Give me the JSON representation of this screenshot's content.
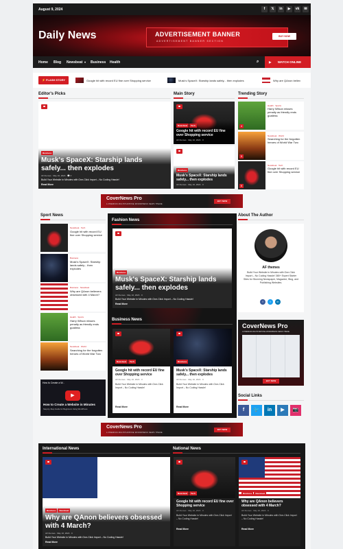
{
  "topbar": {
    "date": "August 9, 2024",
    "social_icons": [
      "f",
      "𝕏",
      "in",
      "▶",
      "vk",
      "✉"
    ]
  },
  "header": {
    "logo": "Daily News",
    "ad_title": "ADVERTISEMENT BANNER",
    "ad_sub": "ADVERTISEMENT BANNER SECTION",
    "ad_button": "BUY NOW"
  },
  "nav": {
    "items": [
      "Home",
      "Blog",
      "Newsbeat",
      "Business",
      "Health"
    ],
    "watch": "WATCH ONLINE"
  },
  "flash": {
    "label": "FLASH STORY",
    "items": [
      "Google hit with record EU fine over Shopping service",
      "Musk's SpaceX: Starship lands safely... then explodes",
      "Why are QAnon believ"
    ]
  },
  "editors": {
    "title": "Editor's Picks",
    "badge": "Business",
    "headline": "Musk's SpaceX: Starship lands safely... then explodes",
    "author": "AF themes",
    "date": "May 10, 2024",
    "comments": "0",
    "excerpt": "Build Your Website in Minutes with One-Click Import – No Coding Hassle!",
    "readmore": "Read More"
  },
  "main_story": {
    "title": "Main Story",
    "items": [
      {
        "badges": [
          "Newsbeat",
          "Tech"
        ],
        "headline": "Google hit with record EU fine over Shopping service",
        "author": "AF themes",
        "date": "May 10, 2024",
        "comments": "0"
      },
      {
        "badges": [
          "Business"
        ],
        "headline": "Musk's SpaceX: Starship lands safely... then explodes",
        "author": "AF themes",
        "date": "May 10, 2024",
        "comments": "0"
      }
    ]
  },
  "trending": {
    "title": "Trending Story",
    "items": [
      {
        "cat": "Health · Sports",
        "headline": "Harry Wilson misses penalty as friendly ends goalless",
        "num": "4"
      },
      {
        "cat": "Newsbeat · World",
        "headline": "Searching for the forgotten heroes of World War Two",
        "num": "5"
      },
      {
        "cat": "Newsbeat · Tech",
        "headline": "Google hit with record EU fine over Shopping service",
        "num": "6"
      }
    ]
  },
  "banner": {
    "title": "CoverNews Pro",
    "sub": "A PREMIUM MULTIPURPOSE WORDPRESS NEWS THEME",
    "button": "BUY NOW"
  },
  "sport": {
    "title": "Sport News",
    "items": [
      {
        "cat": "Newsbeat · Tech",
        "headline": "Google hit with record EU fine over Shopping service"
      },
      {
        "cat": "Business",
        "headline": "Musk's SpaceX: Starship lands safely... then explodes"
      },
      {
        "cat": "Business · Newsbeat",
        "headline": "Why are QAnon believers obsessed with 4 March?"
      },
      {
        "cat": "Health · Sports",
        "headline": "Harry Wilson misses penalty as friendly ends goalless"
      },
      {
        "cat": "Newsbeat · World",
        "headline": "Searching for the forgotten heroes of World War Two"
      }
    ],
    "video_title": "How to Create a Website in Minutes",
    "video_sub": "Step-by-Step Guide for Beginners Using WordPress",
    "video_top": "How to Create a W..."
  },
  "fashion": {
    "title": "Fashion News",
    "badge": "Business",
    "headline": "Musk's SpaceX: Starship lands safely... then explodes",
    "author": "AF themes",
    "date": "May 10, 2024",
    "comments": "0",
    "excerpt": "Build Your Website in Minutes with One-Click Import – No Coding Hassle!",
    "readmore": "Read More"
  },
  "business": {
    "title": "Business News",
    "items": [
      {
        "badges": [
          "Newsbeat",
          "Tech"
        ],
        "headline": "Google hit with record EU fine over Shopping service",
        "author": "AF themes",
        "date": "May 10, 2024",
        "comments": "0",
        "excerpt": "Build Your Website in Minutes with One-Click Import – No Coding Hassle!",
        "readmore": "Read More"
      },
      {
        "badges": [
          "Business"
        ],
        "headline": "Musk's SpaceX: Starship lands safely... then explodes",
        "author": "AF themes",
        "date": "May 10, 2024",
        "comments": "0",
        "excerpt": "Build Your Website in Minutes with One-Click Import – No Coding Hassle!",
        "readmore": "Read More"
      }
    ]
  },
  "author": {
    "title": "About The Author",
    "name": "AF themes",
    "bio": "Build Your Website in Minutes with One-Click Import – No Coding Hassle! 365+ Expert Starter Sites for Stunning Newspaper, Magazine, Blog, and Publishing Websites."
  },
  "social": {
    "title": "Social Links",
    "icons": [
      "f",
      "🐦",
      "in",
      "▶",
      "📷"
    ]
  },
  "international": {
    "title": "International News",
    "badges": [
      "Business",
      "Newsbeat"
    ],
    "headline": "Why are QAnon believers obsessed with 4 March?",
    "author": "AF themes",
    "date": "May 10, 2024",
    "comments": "0",
    "excerpt": "Build Your Website in Minutes with One-Click Import – No Coding Hassle!",
    "readmore": "Read More"
  },
  "national": {
    "title": "National News",
    "items": [
      {
        "badges": [
          "Newsbeat",
          "Tech"
        ],
        "headline": "Google hit with record EU fine over Shopping service",
        "author": "AF themes",
        "date": "May 10, 2024",
        "comments": "0",
        "excerpt": "Build Your Website in Minutes with One-Click Import – No Coding Hassle!",
        "readmore": "Read More"
      },
      {
        "badges": [
          "Business",
          "Newsbeat"
        ],
        "headline": "Why are QAnon believers obsessed with 4 March?",
        "author": "AF themes",
        "date": "May 10, 2024",
        "comments": "0",
        "excerpt": "Build Your Website in Minutes with One-Click Import – No Coding Hassle!",
        "readmore": "Read More"
      }
    ]
  },
  "colors": {
    "accent": "#d31d24",
    "dark": "#1a1a1a"
  }
}
